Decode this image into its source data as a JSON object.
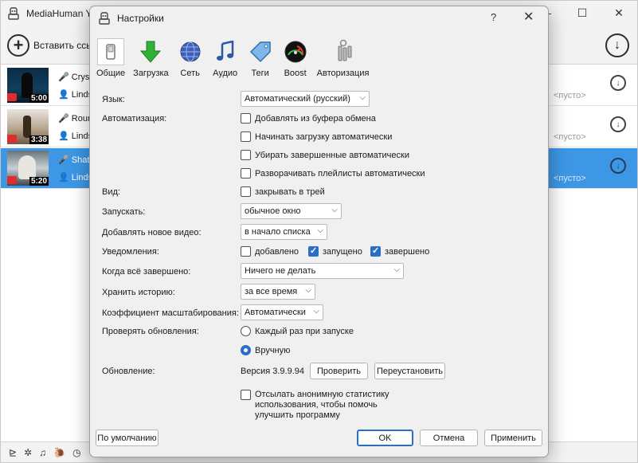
{
  "main": {
    "title": "MediaHuman Y",
    "paste_label": "Вставить ссыл",
    "rows": [
      {
        "line1": "Cryst",
        "line2": "Linds",
        "duration": "5:00",
        "empty": "<пусто>"
      },
      {
        "line1": "Roun",
        "line2": "Linds",
        "duration": "3:38",
        "empty": "<пусто>"
      },
      {
        "line1": "Shatt",
        "line2": "Linds",
        "duration": "5:20",
        "empty": "<пусто>"
      }
    ]
  },
  "dialog": {
    "title": "Настройки",
    "help": "?",
    "tabs": [
      {
        "label": "Общие",
        "icon": "switch-icon"
      },
      {
        "label": "Загрузка",
        "icon": "download-arrow-icon"
      },
      {
        "label": "Сеть",
        "icon": "globe-icon"
      },
      {
        "label": "Аудио",
        "icon": "music-note-icon"
      },
      {
        "label": "Теги",
        "icon": "tag-icon"
      },
      {
        "label": "Boost",
        "icon": "speedometer-icon"
      },
      {
        "label": "Авторизация",
        "icon": "keys-icon"
      }
    ],
    "language": {
      "label": "Язык:",
      "value": "Автоматический (русский)"
    },
    "automation": {
      "label": "Автоматизация:",
      "options": [
        {
          "text": "Добавлять из буфера обмена",
          "checked": false
        },
        {
          "text": "Начинать загрузку автоматически",
          "checked": false
        },
        {
          "text": "Убирать завершенные автоматически",
          "checked": false
        },
        {
          "text": "Разворачивать плейлисты автоматически",
          "checked": false
        }
      ]
    },
    "view": {
      "label": "Вид:",
      "option": "закрывать в трей",
      "checked": false
    },
    "launch": {
      "label": "Запускать:",
      "value": "обычное окно"
    },
    "add_video": {
      "label": "Добавлять новое видео:",
      "value": "в начало списка"
    },
    "notifications": {
      "label": "Уведомления:",
      "added": {
        "text": "добавлено",
        "checked": false
      },
      "started": {
        "text": "запущено",
        "checked": true
      },
      "finished": {
        "text": "завершено",
        "checked": true
      }
    },
    "when_done": {
      "label": "Когда всё завершено:",
      "value": "Ничего не делать"
    },
    "history": {
      "label": "Хранить историю:",
      "value": "за все время"
    },
    "scale": {
      "label": "Коэффициент масштабирования:",
      "value": "Автоматически"
    },
    "updates": {
      "label": "Проверять обновления:",
      "on_launch": "Каждый раз при запуске",
      "manual": "Вручную",
      "selected": "manual"
    },
    "update": {
      "label": "Обновление:",
      "version": "Версия 3.9.9.94",
      "check_btn": "Проверить",
      "reinstall_btn": "Переустановить"
    },
    "stats": {
      "line1": "Отсылать анонимную статистику",
      "line2": "использования, чтобы помочь",
      "line3": "улучшить программу",
      "checked": false
    },
    "buttons": {
      "defaults": "По умолчанию",
      "ok": "OK",
      "cancel": "Отмена",
      "apply": "Применить"
    }
  }
}
